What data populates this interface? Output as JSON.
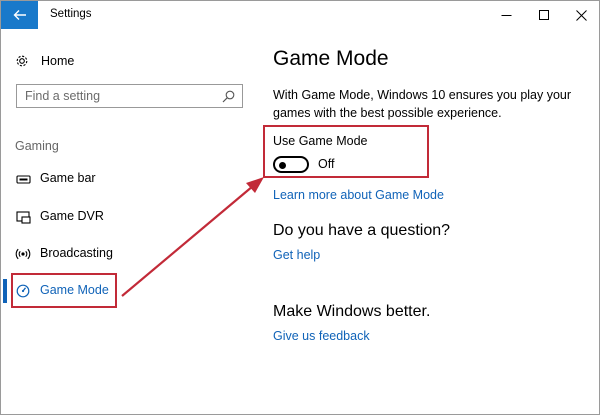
{
  "window": {
    "title": "Settings"
  },
  "sidebar": {
    "home_label": "Home",
    "search_placeholder": "Find a setting",
    "section_label": "Gaming",
    "items": [
      {
        "label": "Game bar",
        "icon": "game-bar-icon"
      },
      {
        "label": "Game DVR",
        "icon": "game-dvr-icon"
      },
      {
        "label": "Broadcasting",
        "icon": "broadcasting-icon"
      },
      {
        "label": "Game Mode",
        "icon": "game-mode-icon",
        "selected": true
      }
    ]
  },
  "main": {
    "title": "Game Mode",
    "description": "With Game Mode, Windows 10 ensures you play your games with the best possible experience.",
    "toggle_label": "Use Game Mode",
    "toggle_state": "Off",
    "toggle_on": false,
    "learn_more_link": "Learn more about Game Mode",
    "question_heading": "Do you have a question?",
    "help_link": "Get help",
    "better_heading": "Make Windows better.",
    "feedback_link": "Give us feedback"
  },
  "colors": {
    "accent": "#1063b8",
    "back_button": "#1979ca",
    "annotation_red": "#c22a38"
  }
}
